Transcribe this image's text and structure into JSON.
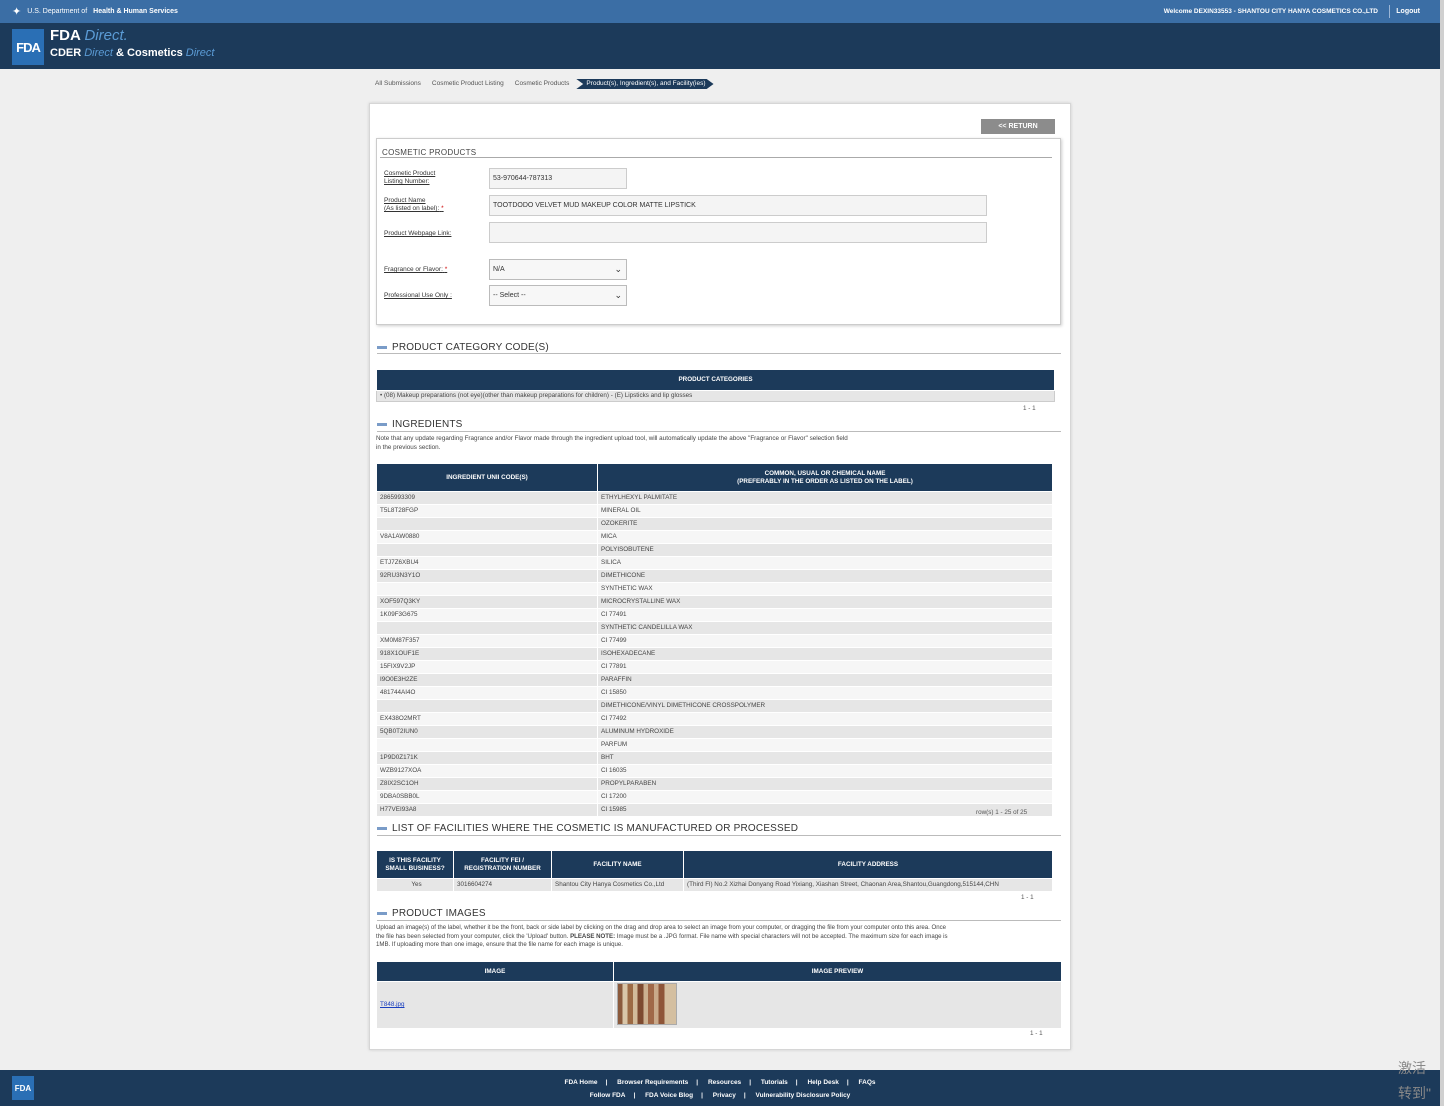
{
  "topbar": {
    "hhs_prefix": "U.S. Department of",
    "hhs_name": "Health & Human Services",
    "welcome": "Welcome DEXIN33553 - SHANTOU CITY HANYA COSMETICS CO.,LTD",
    "logout": "Logout"
  },
  "header": {
    "logo": "FDA",
    "line1_a": "FDA",
    "line1_b": "Direct.",
    "line2_a": "CDER",
    "line2_b": "Direct",
    "line2_c": "&",
    "line2_d": "Cosmetics",
    "line2_e": "Direct"
  },
  "breadcrumb": [
    "All Submissions",
    "Cosmetic Product Listing",
    "Cosmetic Products",
    "Product(s), Ingredient(s), and Facility(ies)"
  ],
  "return_label": "<< RETURN",
  "form": {
    "title": "COSMETIC PRODUCTS",
    "listing_label_1": "Cosmetic Product",
    "listing_label_2": "Listing Number:",
    "listing_value": "53-970644-787313",
    "name_label_1": "Product Name",
    "name_label_2": "(As listed on label):",
    "name_value": "TOOTDODO VELVET MUD MAKEUP COLOR MATTE LIPSTICK",
    "link_label": "Product Webpage Link:",
    "link_value": "",
    "fragrance_label": "Fragrance or Flavor:",
    "fragrance_value": "N/A",
    "pro_label": "Professional Use Only :",
    "pro_value": "-- Select --",
    "required_mark": "*"
  },
  "categories": {
    "heading": "PRODUCT CATEGORY CODE(S)",
    "column": "PRODUCT CATEGORIES",
    "rows": [
      "• (08) Makeup preparations (not eye)(other than makeup preparations for children) - (E) Lipsticks and lip glosses"
    ],
    "pager": "1 - 1"
  },
  "ingredients": {
    "heading": "INGREDIENTS",
    "note_1": "Note that any update regarding Fragrance and/or Flavor made through the ingredient upload tool, will automatically update the above \"Fragrance or Flavor\" selection field",
    "note_2": "in the previous section.",
    "col1": "INGREDIENT UNII CODE(S)",
    "col2_1": "COMMON, USUAL OR CHEMICAL NAME",
    "col2_2": "(PREFERABLY IN THE ORDER AS LISTED ON THE LABEL)",
    "rows": [
      [
        "2865993309",
        "ETHYLHEXYL PALMITATE"
      ],
      [
        "T5L8T28FGP",
        "MINERAL OIL"
      ],
      [
        "",
        "OZOKERITE"
      ],
      [
        "V8A1AW0880",
        "MICA"
      ],
      [
        "",
        "POLYISOBUTENE"
      ],
      [
        "ETJ7Z6XBU4",
        "SILICA"
      ],
      [
        "92RU3N3Y1O",
        "DIMETHICONE"
      ],
      [
        "",
        "SYNTHETIC WAX"
      ],
      [
        "XOF597Q3KY",
        "MICROCRYSTALLINE WAX"
      ],
      [
        "1K09F3G675",
        "CI 77491"
      ],
      [
        "",
        "SYNTHETIC CANDELILLA WAX"
      ],
      [
        "XM0M87F357",
        "CI 77499"
      ],
      [
        "918X1OUF1E",
        "ISOHEXADECANE"
      ],
      [
        "15FIX9V2JP",
        "CI 77891"
      ],
      [
        "I9O0E3H2ZE",
        "PARAFFIN"
      ],
      [
        "481744AI4O",
        "CI 15850"
      ],
      [
        "",
        "DIMETHICONE/VINYL DIMETHICONE CROSSPOLYMER"
      ],
      [
        "EX438O2MRT",
        "CI 77492"
      ],
      [
        "5QB0T2IUN0",
        "ALUMINUM HYDROXIDE"
      ],
      [
        "",
        "PARFUM"
      ],
      [
        "1P9D0Z171K",
        "BHT"
      ],
      [
        "WZB9127XOA",
        "CI 16035"
      ],
      [
        "Z8IX2SC1OH",
        "PROPYLPARABEN"
      ],
      [
        "9DBA0SBB0L",
        "CI 17200"
      ],
      [
        "H77VEI93A8",
        "CI 15985"
      ]
    ],
    "pager": "row(s) 1 - 25 of 25"
  },
  "facilities": {
    "heading": "LIST OF FACILITIES WHERE THE COSMETIC IS MANUFACTURED OR PROCESSED",
    "col1_1": "IS THIS FACILITY",
    "col1_2": "SMALL BUSINESS?",
    "col2_1": "FACILITY FEI /",
    "col2_2": "REGISTRATION NUMBER",
    "col3": "FACILITY NAME",
    "col4": "FACILITY ADDRESS",
    "rows": [
      [
        "Yes",
        "3016604274",
        "Shantou City Hanya Cosmetics Co.,Ltd",
        "(Third Fl) No.2 Xizhai Donyang Road Yixiang, Xiashan Street, Chaonan Area,Shantou,Guangdong,515144,CHN"
      ]
    ],
    "pager": "1 - 1"
  },
  "images": {
    "heading": "PRODUCT IMAGES",
    "note_1": "Upload an image(s) of the label, whether it be the front, back or side label by clicking on the drag and drop area to select an image from your computer, or dragging the file from your computer onto this area. Once",
    "note_2a": "the file has been selected from your computer, click the 'Upload' button.",
    "note_2b": "PLEASE NOTE:",
    "note_2c": "Image must be a .JPG format. File name with special characters will not be accepted. The maximum size for each image is",
    "note_3": "1MB. If uploading more than one image, ensure that the file name for each image is unique.",
    "col1": "IMAGE",
    "col2": "IMAGE PREVIEW",
    "file": "T848.jpg",
    "pager": "1 - 1"
  },
  "footer": {
    "logo": "FDA",
    "row1": [
      "FDA Home",
      "Browser Requirements",
      "Resources",
      "Tutorials",
      "Help Desk",
      "FAQs"
    ],
    "row2": [
      "Follow FDA",
      "FDA Voice Blog",
      "Privacy",
      "Vulnerability Disclosure Policy"
    ],
    "sep": "|"
  },
  "overlay": {
    "line1": "激活",
    "line2": "转到\""
  }
}
